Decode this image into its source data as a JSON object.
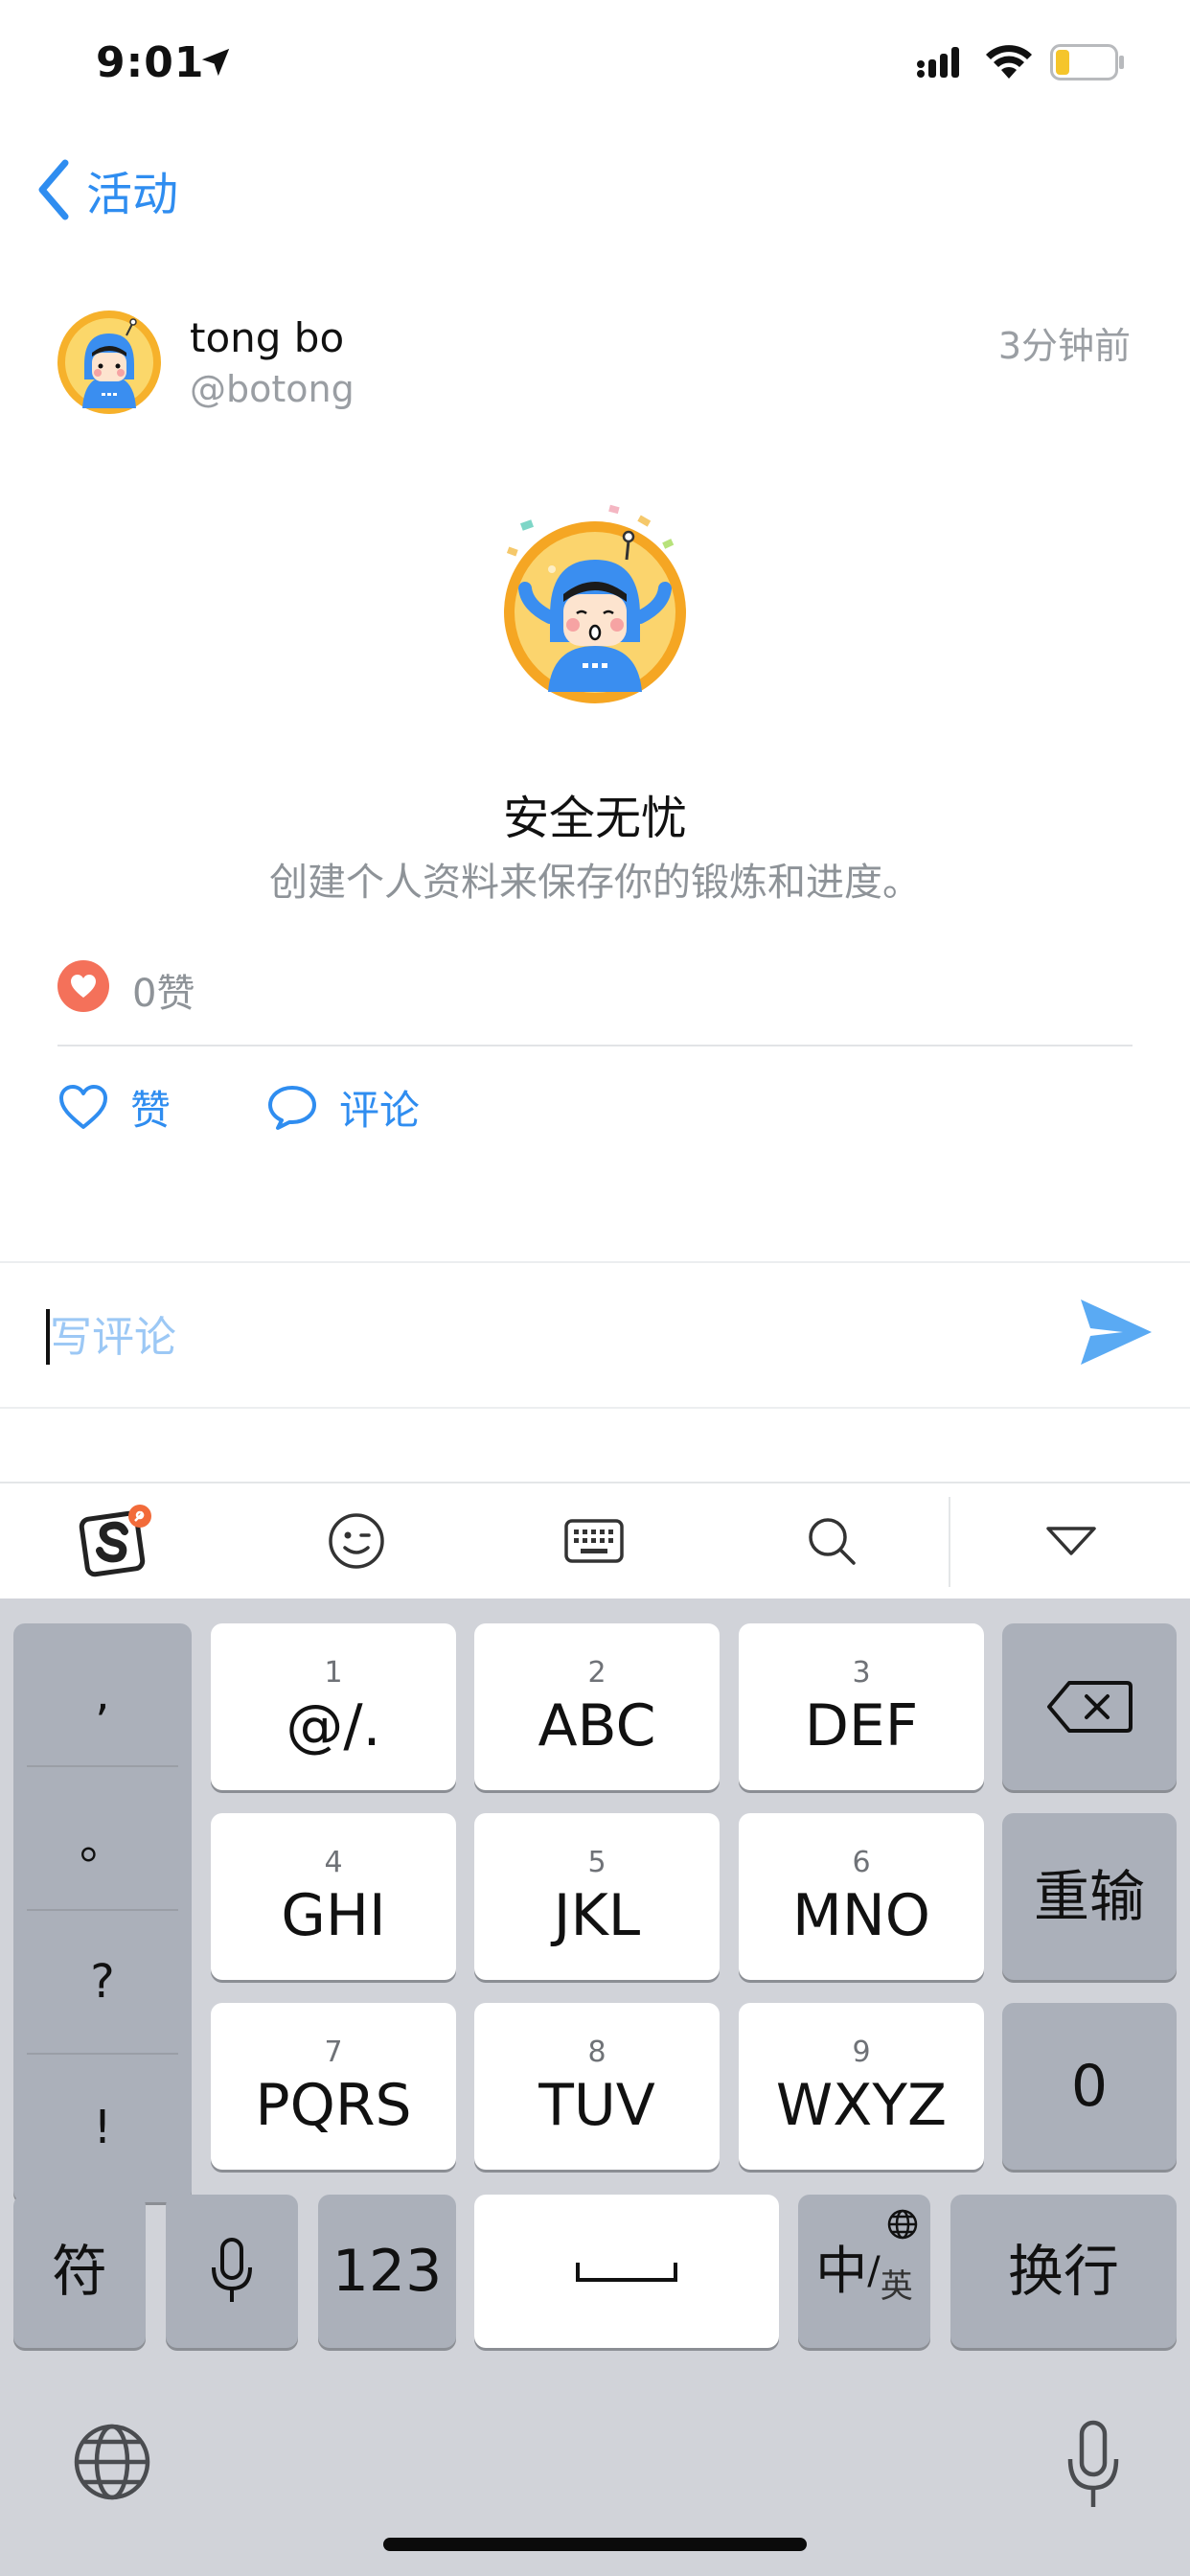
{
  "status_bar": {
    "time": "9:01"
  },
  "nav": {
    "back_label": "活动"
  },
  "post": {
    "user_name": "tong bo",
    "user_handle": "@botong",
    "time_ago": "3分钟前",
    "badge_title": "安全无忧",
    "badge_description": "创建个人资料来保存你的锻炼和进度。",
    "like_count": "0赞"
  },
  "actions": {
    "like_label": "赞",
    "comment_label": "评论"
  },
  "comment": {
    "placeholder": "写评论"
  },
  "keyboard": {
    "punctuation": [
      ",",
      "。",
      "?",
      "!"
    ],
    "rows": [
      [
        {
          "num": "1",
          "label": "@/."
        },
        {
          "num": "2",
          "label": "ABC"
        },
        {
          "num": "3",
          "label": "DEF"
        }
      ],
      [
        {
          "num": "4",
          "label": "GHI"
        },
        {
          "num": "5",
          "label": "JKL"
        },
        {
          "num": "6",
          "label": "MNO"
        }
      ],
      [
        {
          "num": "7",
          "label": "PQRS"
        },
        {
          "num": "8",
          "label": "TUV"
        },
        {
          "num": "9",
          "label": "WXYZ"
        }
      ]
    ],
    "reinput_label": "重输",
    "zero_label": "0",
    "symbols_label": "符",
    "numbers_label": "123",
    "cn_label": "中",
    "en_label": "英",
    "return_label": "换行"
  },
  "colors": {
    "accent": "#2f8df0",
    "like": "#f4715a",
    "keyboard_bg": "#d1d3d9"
  }
}
